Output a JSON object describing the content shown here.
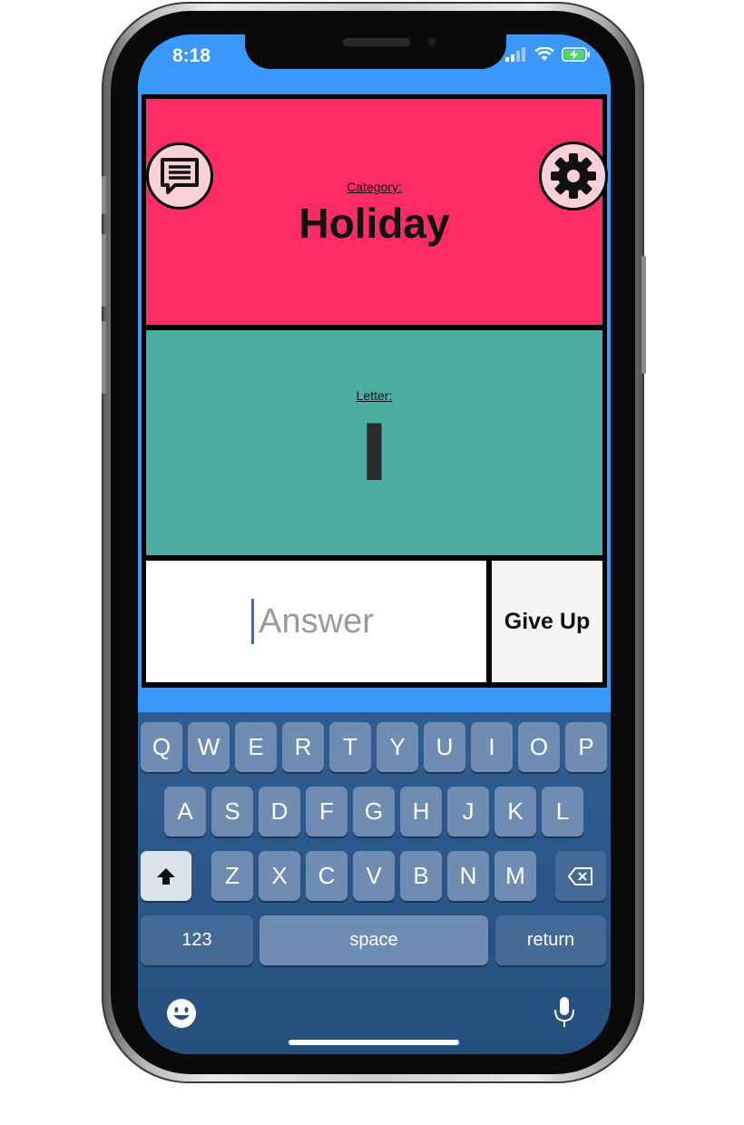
{
  "status_bar": {
    "time": "8:18"
  },
  "category": {
    "label": "Category:",
    "value": "Holiday"
  },
  "letter": {
    "label": "Letter:",
    "value": "I"
  },
  "answer": {
    "placeholder": "Answer",
    "value": ""
  },
  "give_up": {
    "label": "Give Up"
  },
  "keyboard": {
    "row1": [
      "Q",
      "W",
      "E",
      "R",
      "T",
      "Y",
      "U",
      "I",
      "O",
      "P"
    ],
    "row2": [
      "A",
      "S",
      "D",
      "F",
      "G",
      "H",
      "J",
      "K",
      "L"
    ],
    "row3": [
      "Z",
      "X",
      "C",
      "V",
      "B",
      "N",
      "M"
    ],
    "numbers_label": "123",
    "space_label": "space",
    "return_label": "return"
  },
  "colors": {
    "category_bg": "#fd2c65",
    "letter_bg": "#4caea3",
    "app_bg": "#3a98fb",
    "keyboard_bg": "#2f5d91"
  },
  "icons": [
    "chat-icon",
    "gear-icon",
    "signal-icon",
    "wifi-icon",
    "battery-charging-icon",
    "shift-icon",
    "backspace-icon",
    "emoji-icon",
    "microphone-icon"
  ]
}
